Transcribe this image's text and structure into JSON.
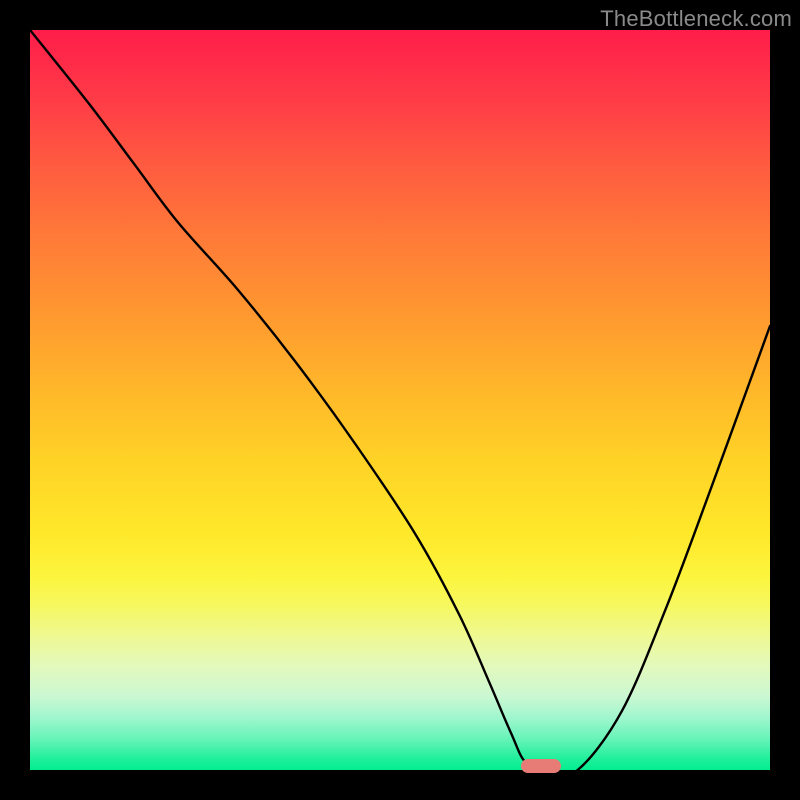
{
  "watermark": "TheBottleneck.com",
  "chart_data": {
    "type": "line",
    "title": "",
    "xlabel": "",
    "ylabel": "",
    "xlim": [
      0,
      100
    ],
    "ylim": [
      0,
      100
    ],
    "grid": false,
    "series": [
      {
        "name": "bottleneck-curve",
        "color": "#000000",
        "x": [
          0,
          8,
          14,
          20,
          28,
          36,
          44,
          52,
          58,
          62,
          65,
          67,
          70,
          74,
          80,
          86,
          92,
          100
        ],
        "y": [
          100,
          90,
          82,
          74,
          65,
          55,
          44,
          32,
          21,
          12,
          5,
          1,
          0,
          0,
          8,
          22,
          38,
          60
        ]
      }
    ],
    "marker": {
      "x": 69,
      "y": 0.5,
      "color": "#E77C77"
    },
    "background_gradient": {
      "top": "#FF1D4A",
      "bottom": "#03EE8F"
    }
  }
}
